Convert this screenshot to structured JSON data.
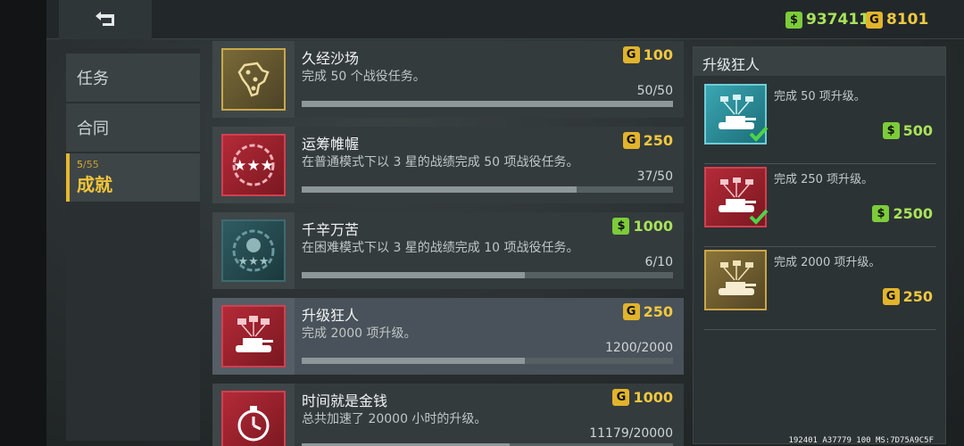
{
  "header": {
    "back_icon": "back-arrow-icon",
    "cash": "937411",
    "gold": "8101",
    "cash_symbol": "$",
    "gold_symbol": "G"
  },
  "nav": {
    "items": [
      {
        "label": "任务"
      },
      {
        "label": "合同"
      },
      {
        "label": "成就",
        "count_done": "5",
        "count_total": "55",
        "active": true
      }
    ]
  },
  "achievements": [
    {
      "title": "久经沙场",
      "desc": "完成 50 个战役任务。",
      "progress": "50/50",
      "fraction": 1.0,
      "reward": "100",
      "currency": "gold",
      "icon": "africa-map-icon",
      "tone": "gold"
    },
    {
      "title": "运筹帷幄",
      "desc": "在普通模式下以 3 星的战绩完成 50 项战役任务。",
      "progress": "37/50",
      "fraction": 0.74,
      "reward": "250",
      "currency": "gold",
      "icon": "three-stars-icon",
      "tone": "red"
    },
    {
      "title": "千辛万苦",
      "desc": "在困难模式下以 3 星的战绩完成 10 项战役任务。",
      "progress": "6/10",
      "fraction": 0.6,
      "reward": "1000",
      "currency": "cash",
      "icon": "skull-stars-icon",
      "tone": "teal"
    },
    {
      "title": "升级狂人",
      "desc": "完成 2000 项升级。",
      "progress": "1200/2000",
      "fraction": 0.6,
      "reward": "250",
      "currency": "gold",
      "icon": "tank-upgrade-icon",
      "tone": "red",
      "selected": true
    },
    {
      "title": "时间就是金钱",
      "desc": "总共加速了 20000 小时的升级。",
      "progress": "11179/20000",
      "fraction": 0.56,
      "reward": "1000",
      "currency": "gold",
      "icon": "stopwatch-icon",
      "tone": "red"
    }
  ],
  "detail": {
    "title": "升级狂人",
    "tiers": [
      {
        "desc": "完成 50 项升级。",
        "reward": "500",
        "currency": "cash",
        "done": true,
        "tone": "teal2"
      },
      {
        "desc": "完成 250 项升级。",
        "reward": "2500",
        "currency": "cash",
        "done": true,
        "tone": "red"
      },
      {
        "desc": "完成 2000 项升级。",
        "reward": "250",
        "currency": "gold",
        "done": false,
        "tone": "gold"
      }
    ]
  },
  "debug_text": "192401 A37779 100 MS:7D75A9C5F",
  "colors": {
    "gold_accent": "#e2b42c",
    "cash_accent": "#7ccc3a",
    "check_green": "#4cd44a"
  }
}
